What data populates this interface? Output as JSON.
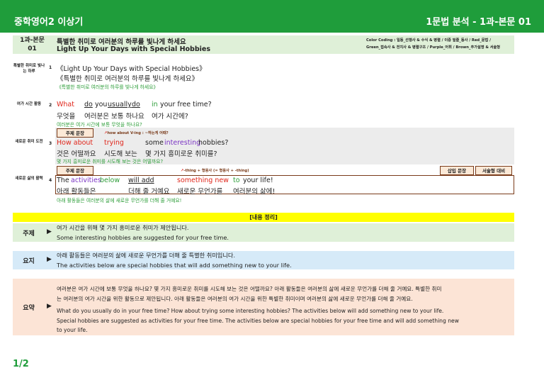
{
  "header": {
    "title": "중학영어2 이상기",
    "right": "1문법 분석 - 1과-본문 01"
  },
  "lesson": {
    "code_line1": "1과-본문",
    "code_line2": "01",
    "title_ko": "특별한 취미로 여러분의 하루를 빛나게 하세요",
    "title_en": "Light Up Your Days with Special Hobbies",
    "color_coding_line1": "Color Coding : 일동_선행사 & 수식 & 병렬 / 이중 밑줄_동사 / Red_문법 /",
    "color_coding_line2": "Green_접속사 & 전치사 & 병렬구조 / Purple_어휘 / Brown_추가설명 & 서술형"
  },
  "sentences": [
    {
      "label": "특별한 취미로 빛나는 하루",
      "num": "1",
      "en": "《Light Up Your Days with Special Hobbies》",
      "ko": "《특별한 취미로 여러분의 하루를 빛나게 하세요》",
      "tr": "《특별한 취미로 여러분의 하루를 빛나게 하세요》"
    },
    {
      "label": "여가 시간 활동",
      "num": "2",
      "en_what": "What",
      "en_do": "do",
      "en_you": "you",
      "en_usually": "usually",
      "en_do2": "do",
      "en_in": "in",
      "en_rest": "your free time?",
      "ko1": "무엇을",
      "ko2": "여러분은 보통 하나요",
      "ko3": "여가 시간에?",
      "tr": "여러분은 여가 시간에 보통 무엇을 하나요?"
    },
    {
      "label": "새로운 취미 도전",
      "num": "3",
      "tag": "주제 문장",
      "hint_arrow": "↗",
      "hint": "how about V-ing : ~하는게 어때?",
      "en_how": "How about",
      "en_trying": "trying",
      "en_some": "some",
      "en_interesting": "interesting",
      "en_hobbies": "hobbies?",
      "ko1": "것은 어떨까요",
      "ko2": "시도해 보는",
      "ko3": "몇 가지 흥미로운 취미를?",
      "tr": "몇 가지 흥미로운 취미를 시도해 보는 것은 어떨까요?"
    },
    {
      "label": "새로운 삶의 활력",
      "num": "4",
      "tag": "주제 문장",
      "hint_arrow": "↗",
      "hint": "-thing + 형용사 (= 형용사 + -thing)",
      "tag_right1": "삽입 문장",
      "tag_right2": "서술형 대비",
      "en_the": "The",
      "en_activities": "activities",
      "en_below": "below",
      "en_will": "will add",
      "en_something": "something new",
      "en_to": "to",
      "en_rest": "your life!",
      "ko1": "아래 활동들은",
      "ko2": "더해 줄 거예요",
      "ko3": "새로운 무언가를",
      "ko4": "여러분의 삶에!",
      "tr": "아래 활동들은 여러분의 삶에 새로운 무언가를 더해 줄 거예요!"
    }
  ],
  "summary": {
    "heading": "[내용 정리]",
    "arrow": "▶",
    "topic_label": "주제",
    "topic_ko": "여가 시간을 위해 몇 가지 흥미로운 취미가 제안됩니다.",
    "topic_en": "Some interesting hobbies are suggested for your free time.",
    "gist_label": "요지",
    "gist_ko": "아래 활동들은 여러분의 삶에 새로운 무언가를 더해 줄 특별한 취미입니다.",
    "gist_en": "The activities below are special hobbies that will add something new to your life.",
    "abstract_label": "요약",
    "abstract_ko1": "여러분은 여가 시간에 보통 무엇을 하나요? 몇 가지 흥미로운 취미를 시도해 보는 것은 어떨까요? 아래 활동들은 여러분의 삶에 새로운 무언가를 더해 줄 거예요. 특별한 취미",
    "abstract_ko2": "는 여러분의 여가 시간을 위한 활동으로 제안됩니다. 아래 활동들은 여러분의 여가 시간을 위한 특별한 취미이며 여러분의 삶에 새로운 무언가를 더해 줄 거예요.",
    "abstract_en1": "What do you usually do in your free time? How about trying some interesting hobbies? The activities below will add something new to your life.",
    "abstract_en2": "Special hobbies are suggested as activities for your free time. The activities below are special hobbies for your free time and will add something new",
    "abstract_en3": "to your life."
  },
  "footer": {
    "page": "1/2"
  },
  "colors": {
    "brand": "#1f9d3b",
    "red": "#e0261b",
    "green": "#2e9e3a",
    "purple": "#7b35c4",
    "brown": "#7a3b1a"
  }
}
